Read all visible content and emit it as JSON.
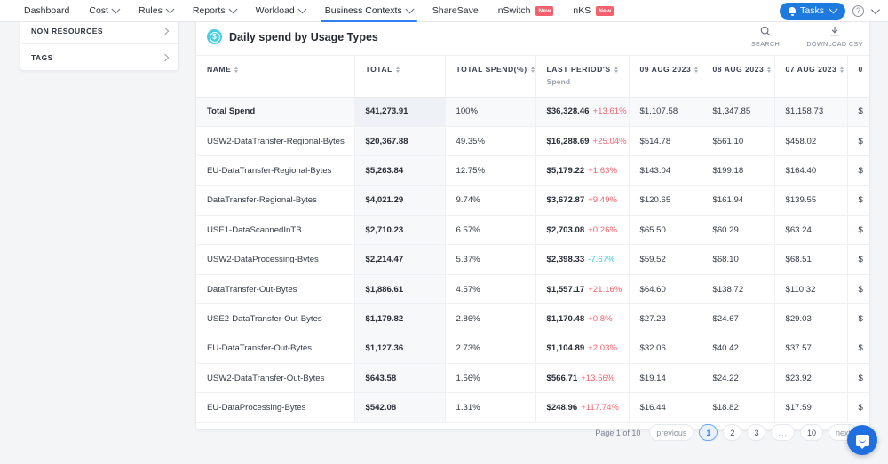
{
  "nav": {
    "items": [
      {
        "label": "Dashboard",
        "dropdown": false,
        "active": false,
        "badge": null
      },
      {
        "label": "Cost",
        "dropdown": true,
        "active": false,
        "badge": null
      },
      {
        "label": "Rules",
        "dropdown": true,
        "active": false,
        "badge": null
      },
      {
        "label": "Reports",
        "dropdown": true,
        "active": false,
        "badge": null
      },
      {
        "label": "Workload",
        "dropdown": true,
        "active": false,
        "badge": null
      },
      {
        "label": "Business Contexts",
        "dropdown": true,
        "active": true,
        "badge": null
      },
      {
        "label": "ShareSave",
        "dropdown": false,
        "active": false,
        "badge": null
      },
      {
        "label": "nSwitch",
        "dropdown": false,
        "active": false,
        "badge": "New"
      },
      {
        "label": "nKS",
        "dropdown": false,
        "active": false,
        "badge": "New"
      }
    ],
    "tasks_label": "Tasks",
    "tasks_icon": "bell-icon",
    "help_icon": "question-circle-icon",
    "accent": "#1f7ae0"
  },
  "sidebar": {
    "items": [
      {
        "label": "NON RESOURCES",
        "icon": "chevron-right-icon"
      },
      {
        "label": "TAGS",
        "icon": "chevron-right-icon"
      }
    ]
  },
  "panel": {
    "icon": "dollar-coin-icon",
    "title": "Daily spend by Usage Types",
    "actions": [
      {
        "label": "SEARCH",
        "icon": "search-icon"
      },
      {
        "label": "DOWNLOAD CSV",
        "icon": "download-icon"
      }
    ]
  },
  "table": {
    "columns": [
      {
        "key": "name",
        "label": "NAME",
        "sub": null,
        "sortable": true
      },
      {
        "key": "total",
        "label": "TOTAL",
        "sub": null,
        "sortable": true
      },
      {
        "key": "pct",
        "label": "TOTAL SPEND(%)",
        "sub": null,
        "sortable": true
      },
      {
        "key": "last",
        "label": "LAST PERIOD'S",
        "sub": "Spend",
        "sortable": true
      },
      {
        "key": "d0",
        "label": "09 AUG 2023",
        "sub": null,
        "sortable": true
      },
      {
        "key": "d1",
        "label": "08 AUG 2023",
        "sub": null,
        "sortable": true
      },
      {
        "key": "d2",
        "label": "07 AUG 2023",
        "sub": null,
        "sortable": true
      },
      {
        "key": "d3",
        "label": "0",
        "sub": null,
        "sortable": false
      }
    ],
    "rows": [
      {
        "name": "Total Spend",
        "total": "$41,273.91",
        "pct": "100%",
        "last": "$36,328.46",
        "delta": "+13.61%",
        "dir": "up",
        "d0": "$1,107.58",
        "d1": "$1,347.85",
        "d2": "$1,158.73",
        "d3": "$",
        "emphasis": true
      },
      {
        "name": "USW2-DataTransfer-Regional-Bytes",
        "total": "$20,367.88",
        "pct": "49.35%",
        "last": "$16,288.69",
        "delta": "+25.04%",
        "dir": "up",
        "d0": "$514.78",
        "d1": "$561.10",
        "d2": "$458.02",
        "d3": "$",
        "emphasis": false
      },
      {
        "name": "EU-DataTransfer-Regional-Bytes",
        "total": "$5,263.84",
        "pct": "12.75%",
        "last": "$5,179.22",
        "delta": "+1.63%",
        "dir": "up",
        "d0": "$143.04",
        "d1": "$199.18",
        "d2": "$164.40",
        "d3": "$",
        "emphasis": false
      },
      {
        "name": "DataTransfer-Regional-Bytes",
        "total": "$4,021.29",
        "pct": "9.74%",
        "last": "$3,672.87",
        "delta": "+9.49%",
        "dir": "up",
        "d0": "$120.65",
        "d1": "$161.94",
        "d2": "$139.55",
        "d3": "$",
        "emphasis": false
      },
      {
        "name": "USE1-DataScannedInTB",
        "total": "$2,710.23",
        "pct": "6.57%",
        "last": "$2,703.08",
        "delta": "+0.26%",
        "dir": "up",
        "d0": "$65.50",
        "d1": "$60.29",
        "d2": "$63.24",
        "d3": "$",
        "emphasis": false
      },
      {
        "name": "USW2-DataProcessing-Bytes",
        "total": "$2,214.47",
        "pct": "5.37%",
        "last": "$2,398.33",
        "delta": "-7.67%",
        "dir": "down",
        "d0": "$59.52",
        "d1": "$68.10",
        "d2": "$68.51",
        "d3": "$",
        "emphasis": false
      },
      {
        "name": "DataTransfer-Out-Bytes",
        "total": "$1,886.61",
        "pct": "4.57%",
        "last": "$1,557.17",
        "delta": "+21.16%",
        "dir": "up",
        "d0": "$64.60",
        "d1": "$138.72",
        "d2": "$110.32",
        "d3": "$",
        "emphasis": false
      },
      {
        "name": "USE2-DataTransfer-Out-Bytes",
        "total": "$1,179.82",
        "pct": "2.86%",
        "last": "$1,170.48",
        "delta": "+0.8%",
        "dir": "up",
        "d0": "$27.23",
        "d1": "$24.67",
        "d2": "$29.03",
        "d3": "$",
        "emphasis": false
      },
      {
        "name": "EU-DataTransfer-Out-Bytes",
        "total": "$1,127.36",
        "pct": "2.73%",
        "last": "$1,104.89",
        "delta": "+2.03%",
        "dir": "up",
        "d0": "$32.06",
        "d1": "$40.42",
        "d2": "$37.57",
        "d3": "$",
        "emphasis": false
      },
      {
        "name": "USW2-DataTransfer-Out-Bytes",
        "total": "$643.58",
        "pct": "1.56%",
        "last": "$566.71",
        "delta": "+13.56%",
        "dir": "up",
        "d0": "$19.14",
        "d1": "$24.22",
        "d2": "$23.92",
        "d3": "$",
        "emphasis": false
      },
      {
        "name": "EU-DataProcessing-Bytes",
        "total": "$542.08",
        "pct": "1.31%",
        "last": "$248.96",
        "delta": "+117.74%",
        "dir": "up",
        "d0": "$16.44",
        "d1": "$18.82",
        "d2": "$17.59",
        "d3": "$",
        "emphasis": false
      }
    ]
  },
  "pagination": {
    "status": "Page 1 of 10",
    "previous": "previous",
    "next": "next",
    "pages": [
      "1",
      "2",
      "3",
      "...",
      "10"
    ],
    "current": "1"
  },
  "widgets": {
    "intercom_icon": "message-bubble-icon"
  },
  "colors": {
    "accent": "#2f7ff0",
    "increase": "#f2646f",
    "decrease": "#3dc9cf",
    "badge": "#f4606c",
    "coin": "#46cfe0"
  }
}
